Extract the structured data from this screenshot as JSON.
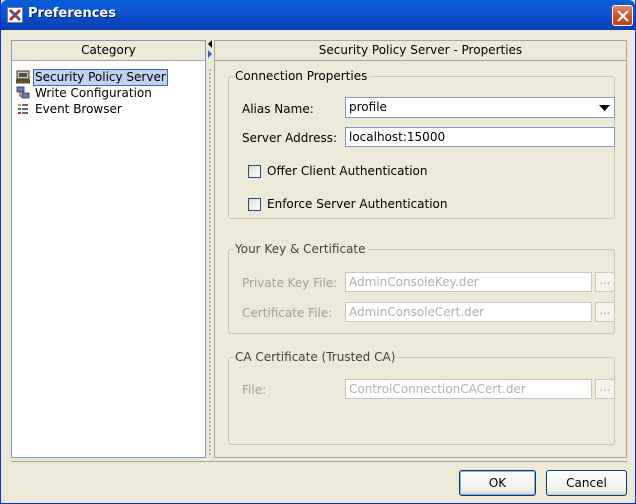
{
  "window": {
    "title": "Preferences"
  },
  "category": {
    "header": "Category",
    "items": [
      {
        "label": "Security Policy Server",
        "icon": "computer-icon",
        "selected": true
      },
      {
        "label": "Write Configuration",
        "icon": "network-write-icon",
        "selected": false
      },
      {
        "label": "Event Browser",
        "icon": "event-list-icon",
        "selected": false
      }
    ]
  },
  "properties": {
    "header": "Security Policy Server - Properties",
    "connection": {
      "legend": "Connection Properties",
      "alias_label": "Alias Name:",
      "alias_value": "profile",
      "server_label": "Server Address:",
      "server_value": "localhost:15000",
      "offer_client_auth": {
        "label": "Offer Client Authentication",
        "checked": false
      },
      "enforce_server_auth": {
        "label": "Enforce Server Authentication",
        "checked": false
      }
    },
    "key_cert": {
      "legend": "Your Key & Certificate",
      "private_key_label": "Private Key File:",
      "private_key_value": "AdminConsoleKey.der",
      "cert_label": "Certificate File:",
      "cert_value": "AdminConsoleCert.der",
      "browse": "..."
    },
    "ca_cert": {
      "legend": "CA Certificate (Trusted CA)",
      "file_label": "File:",
      "file_value": "ControlConnectionCACert.der",
      "browse": "..."
    }
  },
  "buttons": {
    "ok": "OK",
    "cancel": "Cancel"
  },
  "colors": {
    "title_bar": "#0a54d0",
    "selection": "#c1d2ee",
    "selection_border": "#316ac5"
  }
}
